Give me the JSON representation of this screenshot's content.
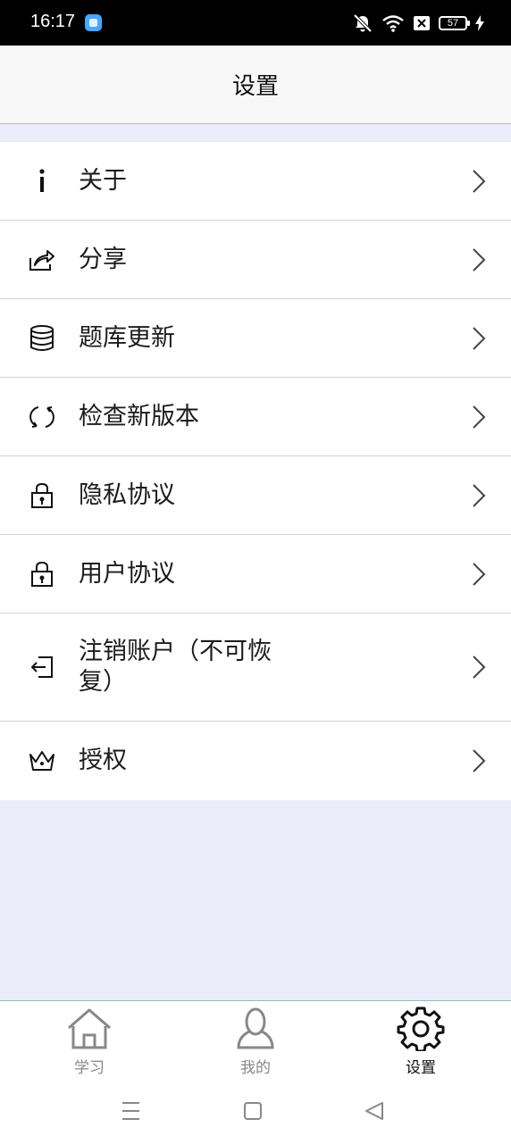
{
  "status_bar": {
    "time": "16:17",
    "battery": "57"
  },
  "header": {
    "title": "设置"
  },
  "menu": {
    "items": [
      {
        "label": "关于",
        "icon": "info-icon"
      },
      {
        "label": "分享",
        "icon": "share-icon"
      },
      {
        "label": "题库更新",
        "icon": "database-icon"
      },
      {
        "label": "检查新版本",
        "icon": "refresh-icon"
      },
      {
        "label": "隐私协议",
        "icon": "lock-icon"
      },
      {
        "label": "用户协议",
        "icon": "lock-icon"
      },
      {
        "label": "注销账户（不可恢复）",
        "icon": "logout-icon"
      },
      {
        "label": "授权",
        "icon": "crown-icon"
      }
    ]
  },
  "bottom_nav": {
    "tabs": [
      {
        "label": "学习",
        "icon": "home-icon",
        "active": false
      },
      {
        "label": "我的",
        "icon": "user-icon",
        "active": false
      },
      {
        "label": "设置",
        "icon": "gear-icon",
        "active": true
      }
    ]
  },
  "colors": {
    "page_background": "#ebedfb",
    "status_bar": "#000000",
    "header_background": "#f8f8f8",
    "inactive_tab": "#888888",
    "active_tab": "#111111"
  }
}
